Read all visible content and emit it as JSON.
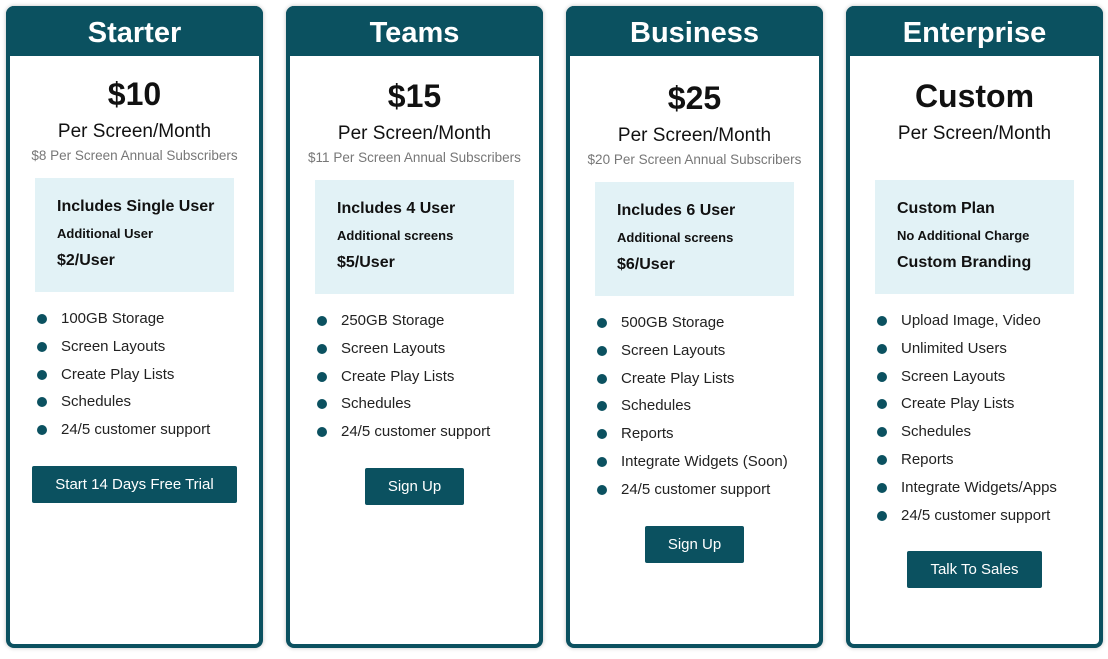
{
  "accent_color": "#0b5160",
  "box_color": "#e2f2f6",
  "plans": [
    {
      "name": "Starter",
      "price": "$10",
      "per": "Per Screen/Month",
      "annual": "$8 Per Screen Annual Subscribers",
      "box": [
        "Includes Single User",
        "Additional User",
        "$2/User"
      ],
      "features": [
        "100GB Storage",
        "Screen Layouts",
        "Create Play Lists",
        "Schedules",
        "24/5 customer support"
      ],
      "button": "Start 14 Days Free Trial"
    },
    {
      "name": "Teams",
      "price": "$15",
      "per": "Per Screen/Month",
      "annual": "$11 Per Screen Annual Subscribers",
      "box": [
        "Includes 4 User",
        "Additional screens",
        "$5/User"
      ],
      "features": [
        "250GB Storage",
        "Screen Layouts",
        "Create Play Lists",
        "Schedules",
        "24/5 customer support"
      ],
      "button": "Sign Up"
    },
    {
      "name": "Business",
      "price": "$25",
      "per": "Per Screen/Month",
      "annual": "$20 Per Screen Annual Subscribers",
      "box": [
        "Includes 6 User",
        "Additional screens",
        "$6/User"
      ],
      "features": [
        "500GB Storage",
        "Screen Layouts",
        "Create Play Lists",
        "Schedules",
        "Reports",
        "Integrate Widgets (Soon)",
        "24/5 customer support"
      ],
      "button": "Sign Up"
    },
    {
      "name": "Enterprise",
      "price": "Custom",
      "per": "Per Screen/Month",
      "annual": "",
      "box": [
        "Custom Plan",
        "No Additional Charge",
        "Custom Branding"
      ],
      "features": [
        "Upload Image, Video",
        "Unlimited Users",
        "Screen Layouts",
        "Create Play Lists",
        "Schedules",
        "Reports",
        "Integrate Widgets/Apps",
        "24/5 customer support"
      ],
      "button": "Talk To Sales"
    }
  ]
}
